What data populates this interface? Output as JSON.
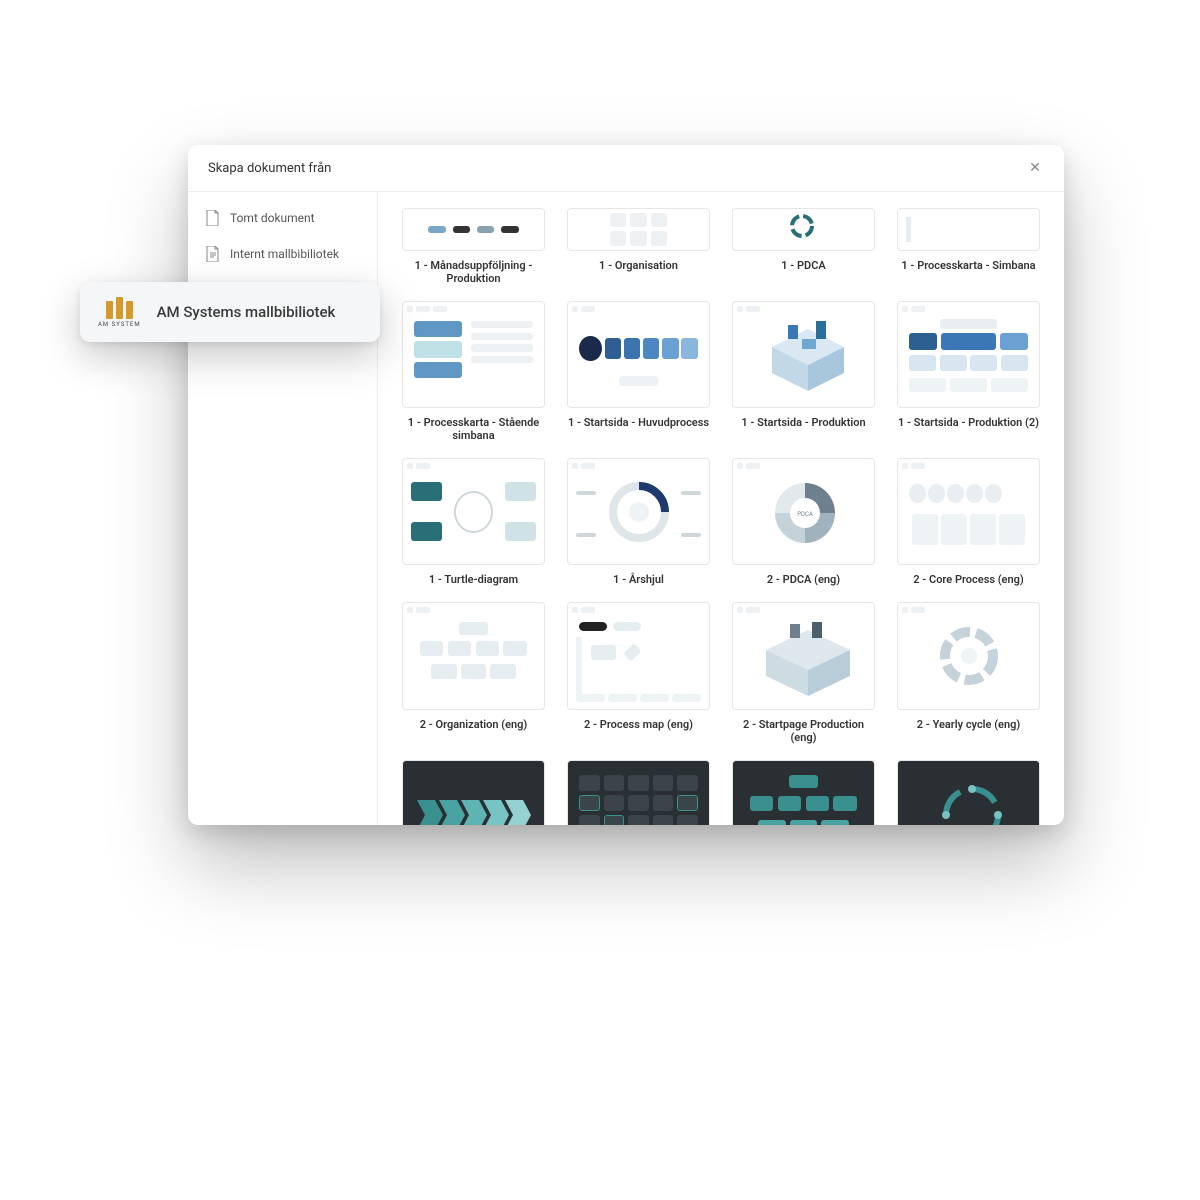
{
  "header": {
    "title": "Skapa dokument från"
  },
  "sidebar": {
    "items": [
      {
        "label": "Tomt dokument",
        "icon": "document-blank-icon"
      },
      {
        "label": "Internt mallbibiliotek",
        "icon": "document-lines-icon"
      }
    ]
  },
  "callout": {
    "brand": "AM SYSTEM",
    "label": "AM Systems mallbibiliotek"
  },
  "templates": {
    "row0": [
      {
        "label": "1 - Månadsuppföljning - Produktion"
      },
      {
        "label": "1 - Organisation"
      },
      {
        "label": "1 - PDCA"
      },
      {
        "label": "1 - Processkarta - Simbana"
      }
    ],
    "row1": [
      {
        "label": "1 - Processkarta - Stående simbana"
      },
      {
        "label": "1 - Startsida - Huvudprocess"
      },
      {
        "label": "1 - Startsida - Produktion"
      },
      {
        "label": "1 - Startsida - Produktion (2)"
      }
    ],
    "row2": [
      {
        "label": "1 - Turtle-diagram"
      },
      {
        "label": "1 - Årshjul"
      },
      {
        "label": "2 - PDCA (eng)"
      },
      {
        "label": "2 - Core Process (eng)"
      }
    ],
    "row3": [
      {
        "label": "2 - Organization (eng)"
      },
      {
        "label": "2 - Process map (eng)"
      },
      {
        "label": "2 - Startpage Production (eng)"
      },
      {
        "label": "2 - Yearly cycle (eng)"
      }
    ],
    "row4": [
      {
        "label": ""
      },
      {
        "label": ""
      },
      {
        "label": ""
      },
      {
        "label": ""
      }
    ]
  },
  "colors": {
    "accentBlue": "#3b76b5",
    "accentTeal": "#2a6f77",
    "slate": "#6e7f8d",
    "dark": "#2a2f33"
  }
}
